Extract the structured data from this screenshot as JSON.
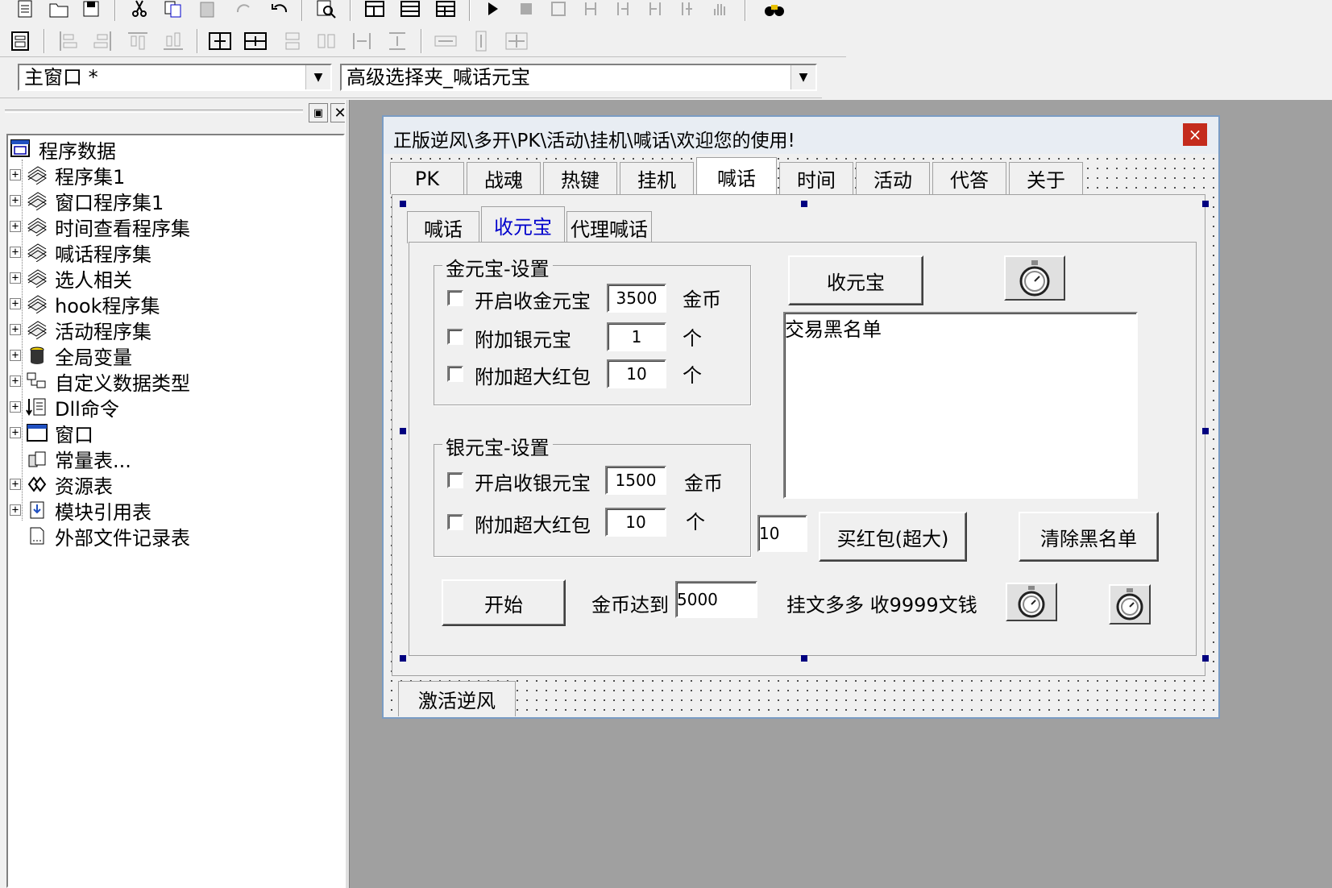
{
  "toolbar1": {
    "icons": [
      "new-file-icon",
      "open-folder-icon",
      "save-icon",
      "cut-icon",
      "copy-icon",
      "paste-icon",
      "redo-icon",
      "undo-icon",
      "find-icon",
      "layout1-icon",
      "layout2-icon",
      "layout3-icon",
      "run-icon",
      "stop-icon",
      "debug1-icon",
      "debug2-icon",
      "debug3-icon",
      "debug4-icon",
      "debug5-icon",
      "hand-icon",
      "binoculars-icon"
    ]
  },
  "toolbar2": {
    "icons": [
      "form-icon",
      "align-left-icon",
      "align-right-icon",
      "align-top-icon",
      "align-bottom-icon",
      "center-h-icon",
      "center-v-icon",
      "same-width-icon",
      "same-height-icon",
      "space-h-icon",
      "space-v-icon",
      "size-h-icon",
      "size-v-icon",
      "size-both-icon"
    ]
  },
  "selectors": {
    "window_combo": "主窗口 *",
    "component_combo": "高级选择夹_喊话元宝"
  },
  "tree": {
    "root": "程序数据",
    "items": [
      {
        "label": "程序集1",
        "icon": "module-icon"
      },
      {
        "label": "窗口程序集1",
        "icon": "module-icon"
      },
      {
        "label": "时间查看程序集",
        "icon": "module-icon"
      },
      {
        "label": "喊话程序集",
        "icon": "module-icon"
      },
      {
        "label": "选人相关",
        "icon": "module-icon"
      },
      {
        "label": "hook程序集",
        "icon": "module-icon"
      },
      {
        "label": "活动程序集",
        "icon": "module-icon"
      },
      {
        "label": "全局变量",
        "icon": "global-var-icon"
      },
      {
        "label": "自定义数据类型",
        "icon": "datatype-icon"
      },
      {
        "label": "Dll命令",
        "icon": "dll-icon"
      },
      {
        "label": "窗口",
        "icon": "window-icon"
      },
      {
        "label": "常量表...",
        "icon": "constant-icon"
      },
      {
        "label": "资源表",
        "icon": "resource-icon"
      },
      {
        "label": "模块引用表",
        "icon": "module-ref-icon"
      },
      {
        "label": "外部文件记录表",
        "icon": "file-record-icon"
      }
    ]
  },
  "form": {
    "title": "正版逆风\\多开\\PK\\活动\\挂机\\喊话\\欢迎您的使用!",
    "close": "×",
    "main_tabs": [
      "PK",
      "战魂",
      "热键",
      "挂机",
      "喊话",
      "时间",
      "活动",
      "代答",
      "关于"
    ],
    "active_main_tab": "喊话",
    "sub_tabs": [
      "喊话",
      "收元宝",
      "代理喊话"
    ],
    "active_sub_tab": "收元宝",
    "gold_group": {
      "title": "金元宝-设置",
      "rows": [
        {
          "label": "开启收金元宝",
          "value": "3500",
          "unit": "金币"
        },
        {
          "label": "附加银元宝",
          "value": "1",
          "unit": "个"
        },
        {
          "label": "附加超大红包",
          "value": "10",
          "unit": "个"
        }
      ]
    },
    "silver_group": {
      "title": "银元宝-设置",
      "rows": [
        {
          "label": "开启收银元宝",
          "value": "1500",
          "unit": "金币"
        },
        {
          "label": "附加超大红包",
          "value": "10",
          "unit": "个"
        }
      ]
    },
    "collect_button": "收元宝",
    "blacklist_text": "交易黑名单",
    "redpack_count": "10",
    "buy_redpack_button": "买红包(超大)",
    "clear_blacklist_button": "清除黑名单",
    "start_button": "开始",
    "gold_reach_label": "金币达到",
    "gold_reach_value": "5000",
    "info_text": "挂文多多  收9999文钱",
    "activate_button": "激活逆风"
  },
  "colors": {
    "accent_link": "#0000cc",
    "close_red": "#c42b1c",
    "handle": "#000080",
    "workspace": "#a0a0a0"
  }
}
